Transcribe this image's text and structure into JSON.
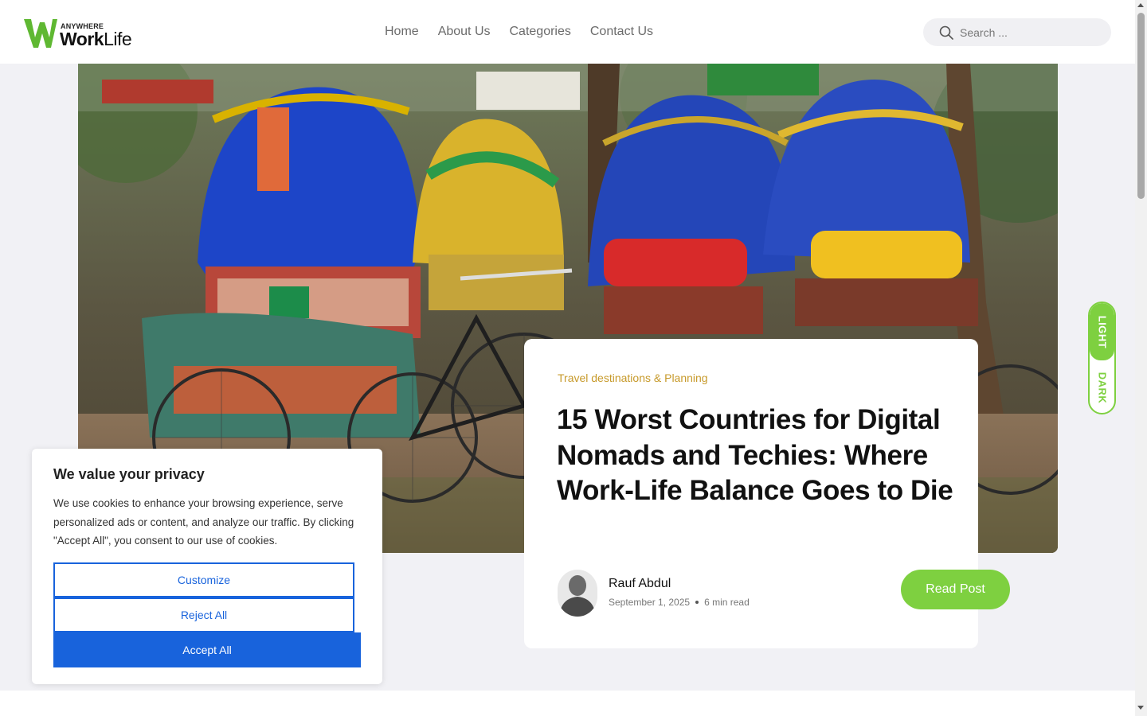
{
  "header": {
    "logo": {
      "small_text": "ANYWHERE",
      "big_text_bold": "Work",
      "big_text_regular": "Life"
    },
    "nav": [
      {
        "label": "Home"
      },
      {
        "label": "About Us"
      },
      {
        "label": "Categories"
      },
      {
        "label": "Contact Us"
      }
    ],
    "search": {
      "placeholder": "Search ...",
      "icon": "search-icon"
    }
  },
  "featured_post": {
    "image_alt": "Colorful cycle rickshaws parked under trees",
    "category": "Travel destinations & Planning",
    "title": "15 Worst Countries for Digital Nomads and Techies: Where Work-Life Balance Goes to Die",
    "author": {
      "name": "Rauf Abdul"
    },
    "date": "September 1, 2025",
    "read_time": "6 min read",
    "read_button": "Read Post"
  },
  "theme_toggle": {
    "light_label": "LIGHT",
    "dark_label": "DARK"
  },
  "cookie_banner": {
    "title": "We value your privacy",
    "text": "We use cookies to enhance your browsing experience, serve personalized ads or content, and analyze our traffic. By clicking \"Accept All\", you consent to our use of cookies.",
    "customize_label": "Customize",
    "reject_label": "Reject All",
    "accept_label": "Accept All"
  },
  "colors": {
    "brand_green": "#7ed040",
    "category_gold": "#c79a2b",
    "cookie_blue": "#1863dc",
    "page_background": "#f1f1f5"
  }
}
